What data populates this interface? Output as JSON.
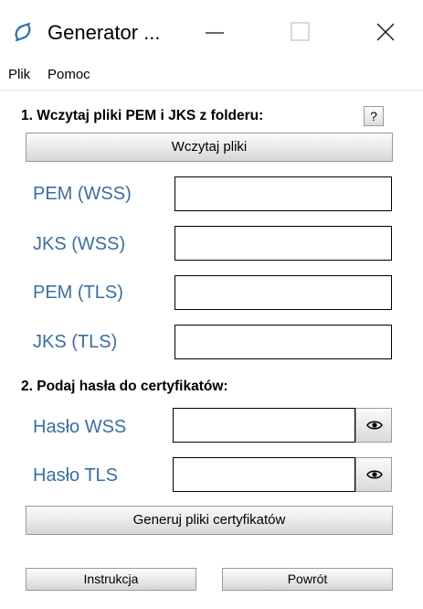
{
  "window": {
    "title": "Generator ..."
  },
  "menu": {
    "items": [
      "Plik",
      "Pomoc"
    ]
  },
  "section1": {
    "title": "1. Wczytaj pliki PEM i JKS z folderu:",
    "help_label": "?",
    "load_button": "Wczytaj pliki"
  },
  "files": {
    "pem_wss": {
      "label": "PEM (WSS)",
      "value": ""
    },
    "jks_wss": {
      "label": "JKS (WSS)",
      "value": ""
    },
    "pem_tls": {
      "label": "PEM (TLS)",
      "value": ""
    },
    "jks_tls": {
      "label": "JKS (TLS)",
      "value": ""
    }
  },
  "section2": {
    "title": "2. Podaj hasła do certyfikatów:"
  },
  "passwords": {
    "wss": {
      "label": "Hasło WSS",
      "value": ""
    },
    "tls": {
      "label": "Hasło TLS",
      "value": ""
    }
  },
  "buttons": {
    "generate": "Generuj pliki certyfikatów",
    "instructions": "Instrukcja",
    "back": "Powrót"
  },
  "icons": {
    "app": "app-logo-icon",
    "minimize": "minimize-icon",
    "maximize": "maximize-icon",
    "close": "close-icon",
    "eye": "eye-icon"
  },
  "colors": {
    "field_label": "#3a6ea5",
    "app_icon": "#2a6fb0"
  }
}
